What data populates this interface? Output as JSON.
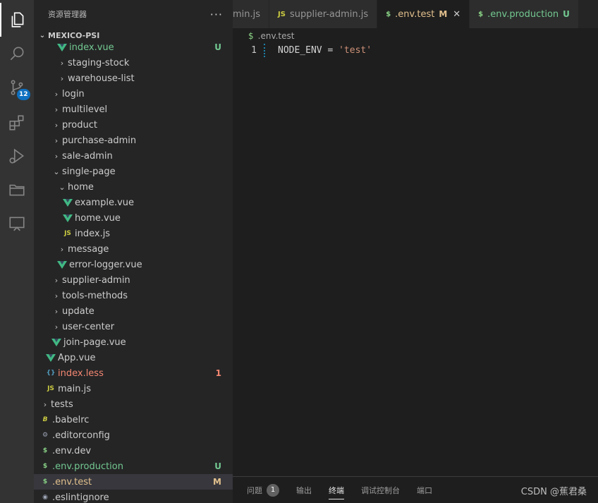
{
  "sidebar": {
    "title": "资源管理器",
    "more": "···",
    "project": "MEXICO-PSI",
    "rows": [
      {
        "label": "index.vue",
        "indent": 3,
        "icon": "vue",
        "twist": "",
        "color": "c-green",
        "status": "U",
        "statusColor": "c-green"
      },
      {
        "label": "staging-stock",
        "indent": 3,
        "icon": "",
        "twist": "›",
        "color": "c-normal",
        "status": "",
        "statusColor": ""
      },
      {
        "label": "warehouse-list",
        "indent": 3,
        "icon": "",
        "twist": "›",
        "color": "c-normal",
        "status": "",
        "statusColor": ""
      },
      {
        "label": "login",
        "indent": 2,
        "icon": "",
        "twist": "›",
        "color": "c-normal",
        "status": "",
        "statusColor": ""
      },
      {
        "label": "multilevel",
        "indent": 2,
        "icon": "",
        "twist": "›",
        "color": "c-normal",
        "status": "",
        "statusColor": ""
      },
      {
        "label": "product",
        "indent": 2,
        "icon": "",
        "twist": "›",
        "color": "c-normal",
        "status": "",
        "statusColor": ""
      },
      {
        "label": "purchase-admin",
        "indent": 2,
        "icon": "",
        "twist": "›",
        "color": "c-normal",
        "status": "",
        "statusColor": ""
      },
      {
        "label": "sale-admin",
        "indent": 2,
        "icon": "",
        "twist": "›",
        "color": "c-normal",
        "status": "",
        "statusColor": ""
      },
      {
        "label": "single-page",
        "indent": 2,
        "icon": "",
        "twist": "⌄",
        "color": "c-normal",
        "status": "",
        "statusColor": ""
      },
      {
        "label": "home",
        "indent": 3,
        "icon": "",
        "twist": "⌄",
        "color": "c-normal",
        "status": "",
        "statusColor": ""
      },
      {
        "label": "example.vue",
        "indent": 4,
        "icon": "vue",
        "twist": "",
        "color": "c-normal",
        "status": "",
        "statusColor": ""
      },
      {
        "label": "home.vue",
        "indent": 4,
        "icon": "vue",
        "twist": "",
        "color": "c-normal",
        "status": "",
        "statusColor": ""
      },
      {
        "label": "index.js",
        "indent": 4,
        "icon": "js",
        "twist": "",
        "color": "c-normal",
        "status": "",
        "statusColor": ""
      },
      {
        "label": "message",
        "indent": 3,
        "icon": "",
        "twist": "›",
        "color": "c-normal",
        "status": "",
        "statusColor": ""
      },
      {
        "label": "error-logger.vue",
        "indent": 3,
        "icon": "vue",
        "twist": "",
        "color": "c-normal",
        "status": "",
        "statusColor": ""
      },
      {
        "label": "supplier-admin",
        "indent": 2,
        "icon": "",
        "twist": "›",
        "color": "c-normal",
        "status": "",
        "statusColor": ""
      },
      {
        "label": "tools-methods",
        "indent": 2,
        "icon": "",
        "twist": "›",
        "color": "c-normal",
        "status": "",
        "statusColor": ""
      },
      {
        "label": "update",
        "indent": 2,
        "icon": "",
        "twist": "›",
        "color": "c-normal",
        "status": "",
        "statusColor": ""
      },
      {
        "label": "user-center",
        "indent": 2,
        "icon": "",
        "twist": "›",
        "color": "c-normal",
        "status": "",
        "statusColor": ""
      },
      {
        "label": "join-page.vue",
        "indent": 2,
        "icon": "vue",
        "twist": "",
        "color": "c-normal",
        "status": "",
        "statusColor": ""
      },
      {
        "label": "App.vue",
        "indent": 1,
        "icon": "vue",
        "twist": "",
        "color": "c-normal",
        "status": "",
        "statusColor": ""
      },
      {
        "label": "index.less",
        "indent": 1,
        "icon": "less",
        "twist": "",
        "color": "c-red",
        "status": "1",
        "statusColor": "c-red"
      },
      {
        "label": "main.js",
        "indent": 1,
        "icon": "js",
        "twist": "",
        "color": "c-normal",
        "status": "",
        "statusColor": ""
      },
      {
        "label": "tests",
        "indent": 0,
        "icon": "",
        "twist": "›",
        "color": "c-normal",
        "status": "",
        "statusColor": ""
      },
      {
        "label": ".babelrc",
        "indent": 0,
        "icon": "babel",
        "twist": "",
        "color": "c-normal",
        "status": "",
        "statusColor": ""
      },
      {
        "label": ".editorconfig",
        "indent": 0,
        "icon": "gear",
        "twist": "",
        "color": "c-normal",
        "status": "",
        "statusColor": ""
      },
      {
        "label": ".env.dev",
        "indent": 0,
        "icon": "dollar",
        "twist": "",
        "color": "c-normal",
        "status": "",
        "statusColor": ""
      },
      {
        "label": ".env.production",
        "indent": 0,
        "icon": "dollar",
        "twist": "",
        "color": "c-green",
        "status": "U",
        "statusColor": "c-green"
      },
      {
        "label": ".env.test",
        "indent": 0,
        "icon": "dollar",
        "twist": "",
        "color": "c-mod",
        "status": "M",
        "statusColor": "c-mod",
        "selected": true
      },
      {
        "label": ".eslintignore",
        "indent": 0,
        "icon": "circle",
        "twist": "",
        "color": "c-normal",
        "status": "",
        "statusColor": ""
      }
    ]
  },
  "activity": {
    "scm_badge": "12"
  },
  "tabs": [
    {
      "label": "min.js",
      "icon": "",
      "iconColor": "",
      "flag": "",
      "flagColor": "",
      "active": false,
      "close": false
    },
    {
      "label": "supplier-admin.js",
      "icon": "JS",
      "iconColor": "#cbcb41",
      "flag": "",
      "flagColor": "",
      "active": false,
      "close": false
    },
    {
      "label": ".env.test",
      "icon": "$",
      "iconColor": "#89d185",
      "flag": "M",
      "flagColor": "#e2c08d",
      "active": true,
      "close": true
    },
    {
      "label": ".env.production",
      "icon": "$",
      "iconColor": "#89d185",
      "flag": "U",
      "flagColor": "#73c991",
      "active": false,
      "close": false
    }
  ],
  "breadcrumb": {
    "icon": "$",
    "file": ".env.test"
  },
  "editor": {
    "line_number": "1",
    "key": "NODE_ENV",
    "op": " = ",
    "value": "'test'"
  },
  "panel": {
    "tabs": [
      {
        "label": "问题",
        "badge": "1",
        "active": false
      },
      {
        "label": "输出",
        "badge": "",
        "active": false
      },
      {
        "label": "终端",
        "badge": "",
        "active": true
      },
      {
        "label": "调试控制台",
        "badge": "",
        "active": false
      },
      {
        "label": "端口",
        "badge": "",
        "active": false
      }
    ],
    "watermark": "CSDN @蕉君桑"
  }
}
